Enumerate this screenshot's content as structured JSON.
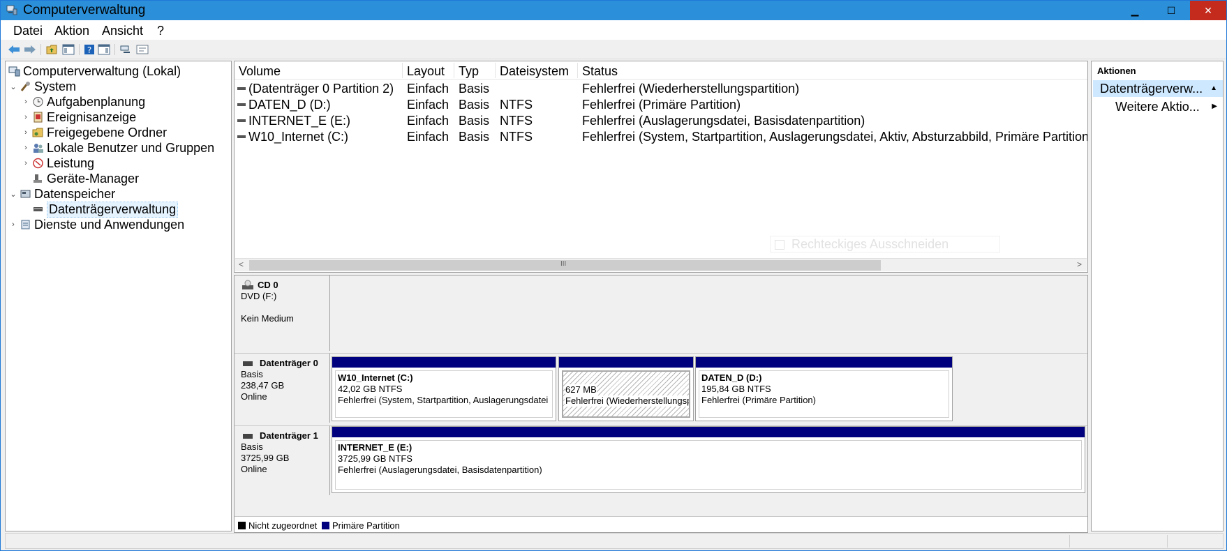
{
  "window": {
    "title": "Computerverwaltung",
    "minimize": "▁",
    "maximize": "☐",
    "close": "✕"
  },
  "menu": [
    "Datei",
    "Aktion",
    "Ansicht",
    "?"
  ],
  "toolbar_icons": [
    "back-arrow-icon",
    "forward-arrow-icon",
    "folder-up-icon",
    "console-tree-icon",
    "help-icon",
    "action-pane-icon",
    "connect-icon",
    "properties-icon"
  ],
  "tree": {
    "root": "Computerverwaltung (Lokal)",
    "system": "System",
    "system_items": [
      "Aufgabenplanung",
      "Ereignisanzeige",
      "Freigegebene Ordner",
      "Lokale Benutzer und Gruppen",
      "Leistung",
      "Geräte-Manager"
    ],
    "storage": "Datenspeicher",
    "storage_item": "Datenträgerverwaltung",
    "services": "Dienste und Anwendungen"
  },
  "volumes": {
    "headers": [
      "Volume",
      "Layout",
      "Typ",
      "Dateisystem",
      "Status"
    ],
    "rows": [
      {
        "volume": "(Datenträger 0 Partition 2)",
        "layout": "Einfach",
        "type": "Basis",
        "fs": "",
        "status": "Fehlerfrei (Wiederherstellungspartition)"
      },
      {
        "volume": "DATEN_D (D:)",
        "layout": "Einfach",
        "type": "Basis",
        "fs": "NTFS",
        "status": "Fehlerfrei (Primäre Partition)"
      },
      {
        "volume": "INTERNET_E (E:)",
        "layout": "Einfach",
        "type": "Basis",
        "fs": "NTFS",
        "status": "Fehlerfrei (Auslagerungsdatei, Basisdatenpartition)"
      },
      {
        "volume": "W10_Internet (C:)",
        "layout": "Einfach",
        "type": "Basis",
        "fs": "NTFS",
        "status": "Fehlerfrei (System, Startpartition, Auslagerungsdatei, Aktiv, Absturzabbild, Primäre Partition)"
      }
    ],
    "hscroll_grip": "III",
    "left_arrow": "<",
    "right_arrow": ">"
  },
  "overlay_text": "Rechteckiges Ausschneiden",
  "disks": {
    "cd0": {
      "name": "CD 0",
      "type": "DVD (F:)",
      "media": "Kein Medium"
    },
    "disk0": {
      "name": "Datenträger 0",
      "type": "Basis",
      "size": "238,47 GB",
      "state": "Online",
      "partitions": [
        {
          "title": "W10_Internet  (C:)",
          "size": "42,02 GB NTFS",
          "status": "Fehlerfrei (System, Startpartition, Auslagerungsdatei"
        },
        {
          "title": "",
          "size": "627 MB",
          "status": "Fehlerfrei (Wiederherstellungsp"
        },
        {
          "title": "DATEN_D  (D:)",
          "size": "195,84 GB NTFS",
          "status": "Fehlerfrei (Primäre Partition)"
        }
      ]
    },
    "disk1": {
      "name": "Datenträger 1",
      "type": "Basis",
      "size": "3725,99 GB",
      "state": "Online",
      "partitions": [
        {
          "title": "INTERNET_E  (E:)",
          "size": "3725,99 GB NTFS",
          "status": "Fehlerfrei (Auslagerungsdatei, Basisdatenpartition)"
        }
      ]
    }
  },
  "legend": {
    "unallocated": "Nicht zugeordnet",
    "primary": "Primäre Partition",
    "unallocated_color": "#000000",
    "primary_color": "#00007f"
  },
  "actions": {
    "header": "Aktionen",
    "selected": "Datenträgerverw...",
    "more": "Weitere Aktio..."
  }
}
